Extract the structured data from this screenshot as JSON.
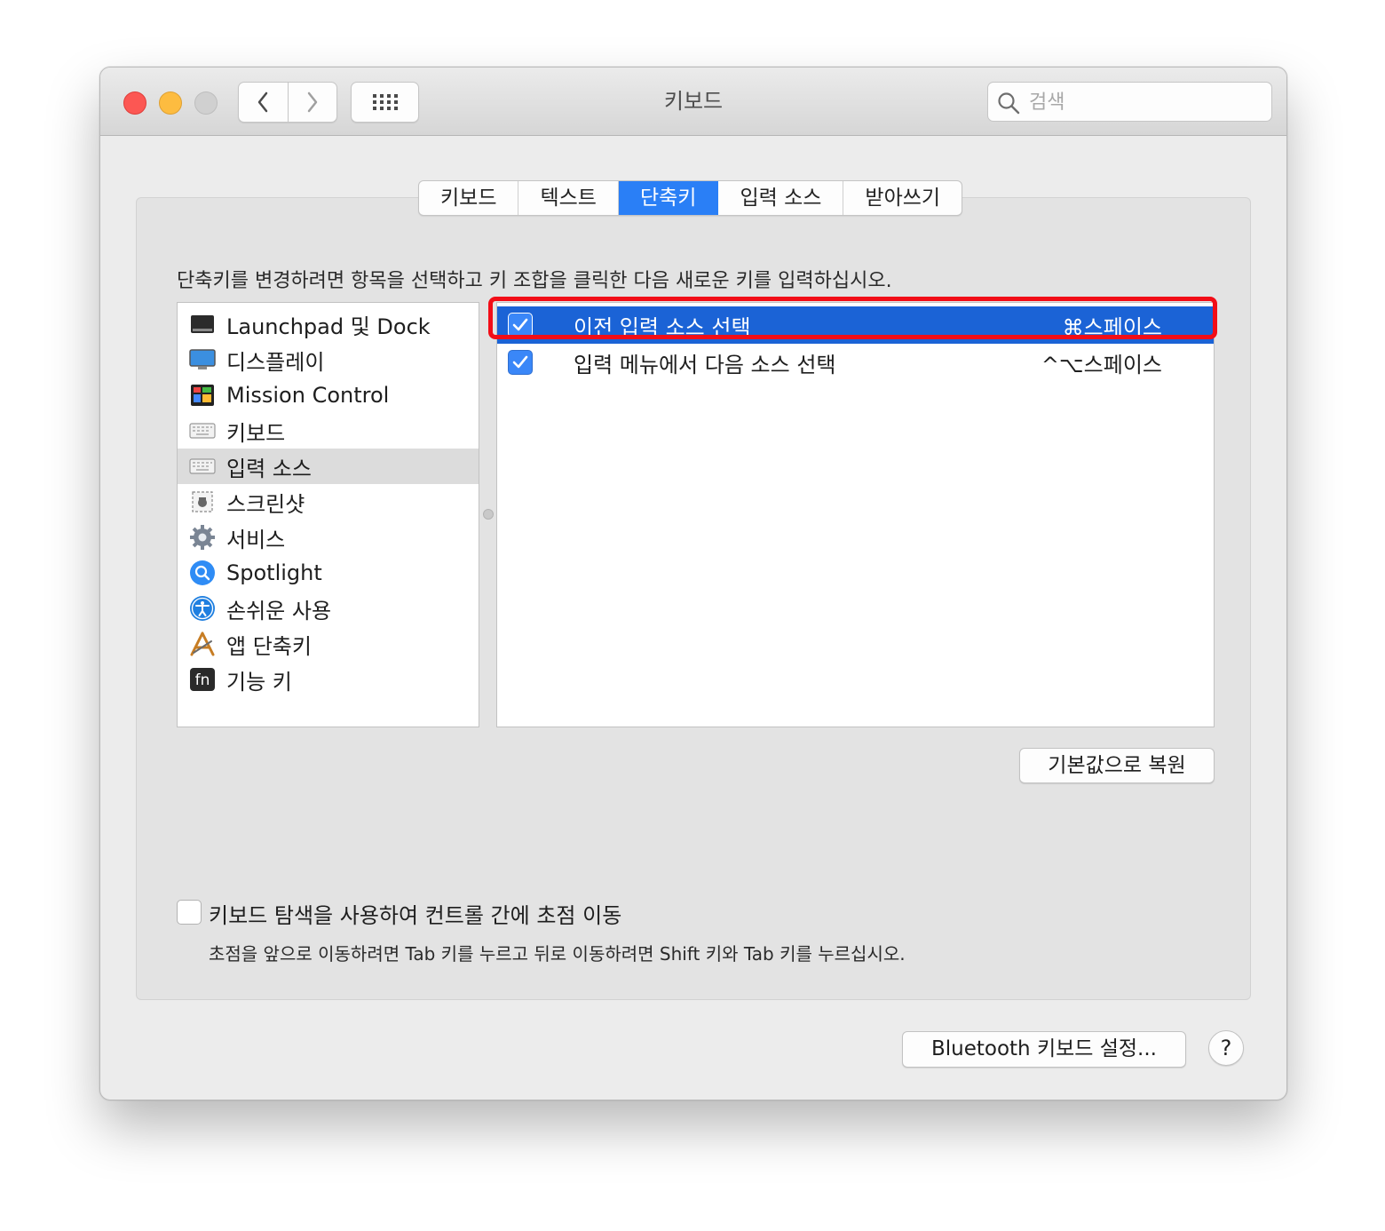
{
  "window": {
    "title": "키보드",
    "search_placeholder": "검색"
  },
  "tabs": [
    {
      "label": "키보드",
      "active": false
    },
    {
      "label": "텍스트",
      "active": false
    },
    {
      "label": "단축키",
      "active": true
    },
    {
      "label": "입력 소스",
      "active": false
    },
    {
      "label": "받아쓰기",
      "active": false
    }
  ],
  "instructions": "단축키를 변경하려면 항목을 선택하고 키 조합을 클릭한 다음 새로운 키를 입력하십시오.",
  "categories": [
    {
      "label": "Launchpad 및 Dock",
      "icon": "launchpad-dock-icon"
    },
    {
      "label": "디스플레이",
      "icon": "display-icon"
    },
    {
      "label": "Mission Control",
      "icon": "mission-control-icon"
    },
    {
      "label": "키보드",
      "icon": "keyboard-icon"
    },
    {
      "label": "입력 소스",
      "icon": "keyboard-icon",
      "selected": true
    },
    {
      "label": "스크린샷",
      "icon": "screenshot-icon"
    },
    {
      "label": "서비스",
      "icon": "gear-icon"
    },
    {
      "label": "Spotlight",
      "icon": "spotlight-icon"
    },
    {
      "label": "손쉬운 사용",
      "icon": "accessibility-icon"
    },
    {
      "label": "앱 단축키",
      "icon": "app-shortcuts-icon"
    },
    {
      "label": "기능 키",
      "icon": "fn-key-icon"
    }
  ],
  "shortcuts": [
    {
      "label": "이전 입력 소스 선택",
      "key": "⌘스페이스",
      "checked": true,
      "selected": true
    },
    {
      "label": "입력 메뉴에서 다음 소스 선택",
      "key": "^⌥스페이스",
      "checked": true,
      "selected": false
    }
  ],
  "restore_button": "기본값으로 복원",
  "keyboard_navigation": {
    "label": "키보드 탐색을 사용하여 컨트롤 간에 초점 이동",
    "checked": false,
    "hint": "초점을 앞으로 이동하려면 Tab 키를 누르고 뒤로 이동하려면 Shift 키와 Tab 키를 누르십시오."
  },
  "bluetooth_button": "Bluetooth 키보드 설정...",
  "help_button": "?",
  "colors": {
    "accent": "#2a7ff6",
    "selection": "#1b63d6",
    "highlight_box": "#f20d17"
  }
}
